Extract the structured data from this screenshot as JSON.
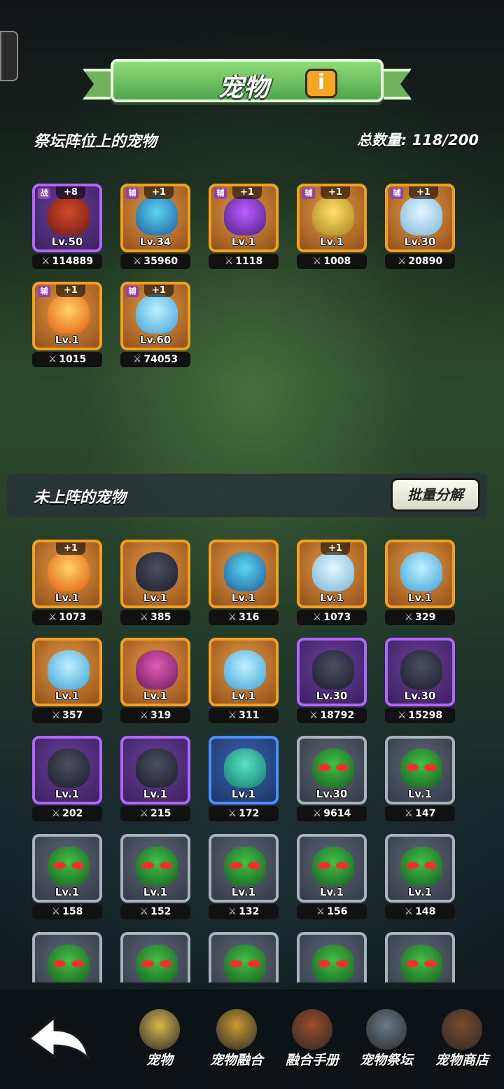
{
  "header": {
    "title": "宠物",
    "info_icon": "i"
  },
  "altar_section": {
    "title": "祭坛阵位上的宠物",
    "count": "总数量: 118/200"
  },
  "unassigned_section": {
    "title": "未上阵的宠物",
    "batch_button": "批量分解"
  },
  "altar_pets": [
    {
      "level": "Lv.50",
      "power": "114889",
      "plus": "+8",
      "badge": "战",
      "frame": "purple",
      "creature": "c-red"
    },
    {
      "level": "Lv.34",
      "power": "35960",
      "plus": "+1",
      "badge": "辅",
      "frame": "orange",
      "creature": "c-blue"
    },
    {
      "level": "Lv.1",
      "power": "1118",
      "plus": "+1",
      "badge": "辅",
      "frame": "orange",
      "creature": "c-purple"
    },
    {
      "level": "Lv.1",
      "power": "1008",
      "plus": "+1",
      "badge": "辅",
      "frame": "orange",
      "creature": "c-gold"
    },
    {
      "level": "Lv.30",
      "power": "20890",
      "plus": "+1",
      "badge": "辅",
      "frame": "orange",
      "creature": "c-white"
    },
    {
      "level": "Lv.1",
      "power": "1015",
      "plus": "+1",
      "badge": "辅",
      "frame": "orange",
      "creature": "c-fire"
    },
    {
      "level": "Lv.60",
      "power": "74053",
      "plus": "+1",
      "badge": "辅",
      "frame": "orange",
      "creature": "c-ice"
    }
  ],
  "unassigned_pets": [
    {
      "level": "Lv.1",
      "power": "1073",
      "plus": "+1",
      "frame": "orange",
      "creature": "c-fire"
    },
    {
      "level": "Lv.1",
      "power": "385",
      "plus": "",
      "frame": "orange",
      "creature": "c-dark"
    },
    {
      "level": "Lv.1",
      "power": "316",
      "plus": "",
      "frame": "orange",
      "creature": "c-blue"
    },
    {
      "level": "Lv.1",
      "power": "1073",
      "plus": "+1",
      "frame": "orange",
      "creature": "c-white"
    },
    {
      "level": "Lv.1",
      "power": "329",
      "plus": "",
      "frame": "orange",
      "creature": "c-ice"
    },
    {
      "level": "Lv.1",
      "power": "357",
      "plus": "",
      "frame": "orange",
      "creature": "c-ice"
    },
    {
      "level": "Lv.1",
      "power": "319",
      "plus": "",
      "frame": "orange",
      "creature": "c-pink"
    },
    {
      "level": "Lv.1",
      "power": "311",
      "plus": "",
      "frame": "orange",
      "creature": "c-ice"
    },
    {
      "level": "Lv.30",
      "power": "18792",
      "plus": "",
      "frame": "purple",
      "creature": "c-dark"
    },
    {
      "level": "Lv.30",
      "power": "15298",
      "plus": "",
      "frame": "purple",
      "creature": "c-dark"
    },
    {
      "level": "Lv.1",
      "power": "202",
      "plus": "",
      "frame": "purple",
      "creature": "c-dark"
    },
    {
      "level": "Lv.1",
      "power": "215",
      "plus": "",
      "frame": "purple",
      "creature": "c-dark"
    },
    {
      "level": "Lv.1",
      "power": "172",
      "plus": "",
      "frame": "blue",
      "creature": "c-teal"
    },
    {
      "level": "Lv.30",
      "power": "9614",
      "plus": "",
      "frame": "gray",
      "creature": "c-green"
    },
    {
      "level": "Lv.1",
      "power": "147",
      "plus": "",
      "frame": "gray",
      "creature": "c-green"
    },
    {
      "level": "Lv.1",
      "power": "158",
      "plus": "",
      "frame": "gray",
      "creature": "c-green"
    },
    {
      "level": "Lv.1",
      "power": "152",
      "plus": "",
      "frame": "gray",
      "creature": "c-green"
    },
    {
      "level": "Lv.1",
      "power": "132",
      "plus": "",
      "frame": "gray",
      "creature": "c-green"
    },
    {
      "level": "Lv.1",
      "power": "156",
      "plus": "",
      "frame": "gray",
      "creature": "c-green"
    },
    {
      "level": "Lv.1",
      "power": "148",
      "plus": "",
      "frame": "gray",
      "creature": "c-green"
    },
    {
      "level": "",
      "power": "",
      "plus": "",
      "frame": "gray",
      "creature": "c-green"
    },
    {
      "level": "",
      "power": "",
      "plus": "",
      "frame": "gray",
      "creature": "c-green"
    },
    {
      "level": "",
      "power": "",
      "plus": "",
      "frame": "gray",
      "creature": "c-green"
    },
    {
      "level": "",
      "power": "",
      "plus": "",
      "frame": "gray",
      "creature": "c-green"
    },
    {
      "level": "",
      "power": "",
      "plus": "",
      "frame": "gray",
      "creature": "c-green"
    }
  ],
  "bottom_nav": [
    {
      "label": "宠物",
      "icon": "pet-icon"
    },
    {
      "label": "宠物融合",
      "icon": "fusion-icon"
    },
    {
      "label": "融合手册",
      "icon": "handbook-icon"
    },
    {
      "label": "宠物祭坛",
      "icon": "altar-icon"
    },
    {
      "label": "宠物商店",
      "icon": "shop-icon"
    }
  ],
  "colors": {
    "frame_orange": "#f2a020",
    "frame_purple": "#b166ff",
    "frame_blue": "#4c8dff",
    "frame_gray": "#aab2bc",
    "title_green": "#6fb45a"
  }
}
